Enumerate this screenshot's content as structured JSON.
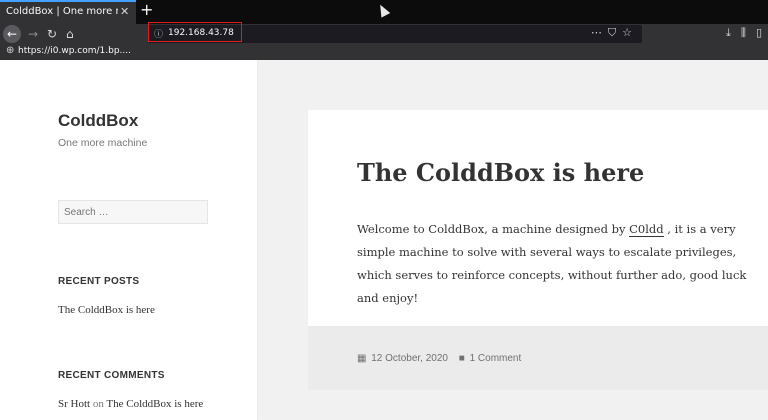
{
  "browser": {
    "tab_title": "ColddBox | One more machine",
    "tab_close": "✕",
    "new_tab": "+",
    "url": "192.168.43.78",
    "status_url": "https://i0.wp.com/1.bp....",
    "icons": {
      "back": "back-arrow-icon",
      "forward": "forward-arrow-icon",
      "reload": "reload-icon",
      "home": "home-icon",
      "info": "info-icon",
      "more": "ellipsis-icon",
      "pocket": "pocket-icon",
      "bookmark": "star-icon",
      "download": "download-icon",
      "library": "library-icon",
      "sidebar": "sidebar-icon",
      "globe": "globe-icon"
    },
    "colors": {
      "chrome": "#323234",
      "highlight": "#e21b1b",
      "active_tab": "#45a1ff"
    }
  },
  "sidebar": {
    "site_title": "ColddBox",
    "site_description": "One more machine",
    "search_placeholder": "Search …",
    "recent_posts_title": "RECENT POSTS",
    "recent_posts": [
      "The ColddBox is here"
    ],
    "recent_comments_title": "RECENT COMMENTS",
    "recent_comment": {
      "author": "Sr Hott",
      "on": "on",
      "post": "The ColddBox is here"
    }
  },
  "post": {
    "title": "The ColddBox is here",
    "body_before": "Welcome to ColddBox, a machine designed by ",
    "author_link": "C0ldd",
    "body_after": " , it is a very simple machine to solve with several ways to escalate privileges, which serves to reinforce concepts, without further ado, good luck and enjoy!",
    "date": "12 October, 2020",
    "comments": "1 Comment"
  }
}
